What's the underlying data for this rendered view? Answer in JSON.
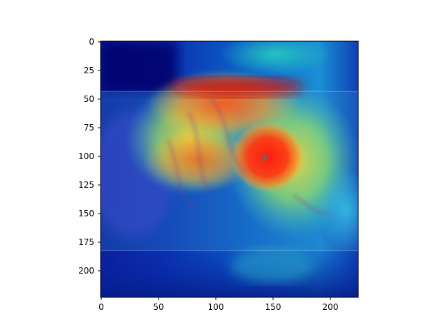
{
  "axes": {
    "x_tick_labels": [
      "0",
      "50",
      "100",
      "150",
      "200"
    ],
    "y_tick_labels": [
      "0",
      "25",
      "50",
      "75",
      "100",
      "125",
      "150",
      "175",
      "200"
    ]
  },
  "image": {
    "subject": "hurricane-satellite-image-with-heatmap-overlay",
    "colormap": "jet",
    "colors": {
      "deep_blue": "#00007f",
      "blue": "#1240c8",
      "cyan": "#38d8d0",
      "green": "#8ff060",
      "yellow": "#f0e040",
      "orange": "#ff7a1e",
      "red": "#ff2a10"
    }
  }
}
